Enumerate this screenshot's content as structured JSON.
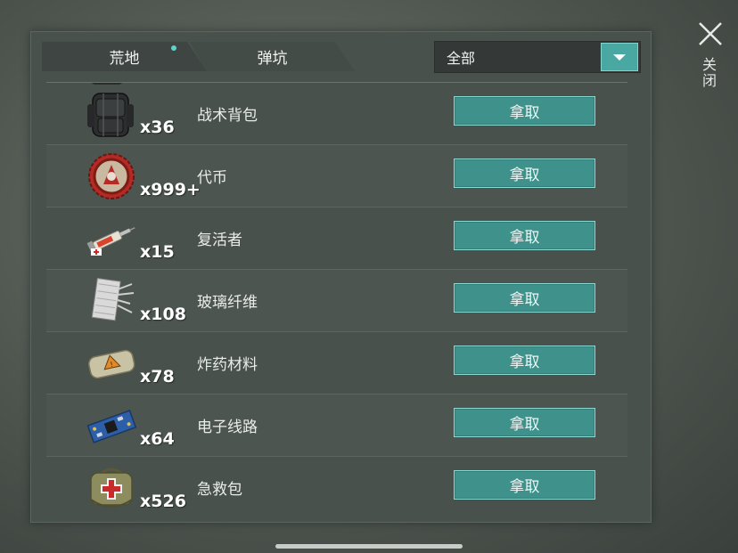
{
  "tabs": [
    {
      "label": "荒地",
      "notification_dot": true
    },
    {
      "label": "弹坑",
      "notification_dot": false
    }
  ],
  "filter": {
    "selected": "全部",
    "icon": "chevron-down-icon"
  },
  "close": {
    "label": "关闭",
    "icon": "close-icon"
  },
  "items": [
    {
      "name": "战术背包",
      "qty": "x36",
      "button": "拿取",
      "icon": "backpack-icon"
    },
    {
      "name": "代币",
      "qty": "x999+",
      "button": "拿取",
      "icon": "bottle-cap-icon"
    },
    {
      "name": "复活者",
      "qty": "x15",
      "button": "拿取",
      "icon": "syringe-icon"
    },
    {
      "name": "玻璃纤维",
      "qty": "x108",
      "button": "拿取",
      "icon": "fiberglass-icon"
    },
    {
      "name": "炸药材料",
      "qty": "x78",
      "button": "拿取",
      "icon": "explosive-icon"
    },
    {
      "name": "电子线路",
      "qty": "x64",
      "button": "拿取",
      "icon": "circuit-board-icon"
    },
    {
      "name": "急救包",
      "qty": "x526",
      "button": "拿取",
      "icon": "first-aid-kit-icon"
    }
  ]
}
